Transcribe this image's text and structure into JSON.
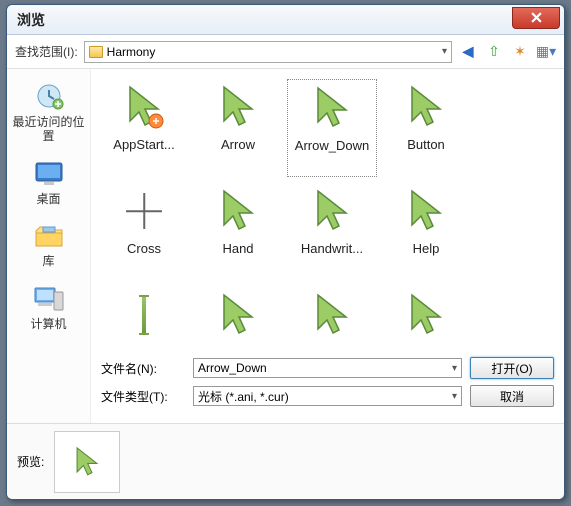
{
  "window": {
    "title": "浏览"
  },
  "toolbar": {
    "lookin_label": "查找范围(I):",
    "folder": "Harmony",
    "icons": {
      "back": "←",
      "up": "↥",
      "new": "📁",
      "views": "▦"
    }
  },
  "sidebar": {
    "items": [
      {
        "label": "最近访问的位置"
      },
      {
        "label": "桌面"
      },
      {
        "label": "库"
      },
      {
        "label": "计算机"
      }
    ]
  },
  "files": [
    {
      "label": "AppStart...",
      "icon": "arrow",
      "badge": true
    },
    {
      "label": "Arrow",
      "icon": "arrow"
    },
    {
      "label": "Arrow_Down",
      "icon": "arrow",
      "selected": true
    },
    {
      "label": "Button",
      "icon": "arrow"
    },
    {
      "label": "Cross",
      "icon": "cross"
    },
    {
      "label": "Hand",
      "icon": "arrow"
    },
    {
      "label": "Handwrit...",
      "icon": "arrow"
    },
    {
      "label": "Help",
      "icon": "arrow"
    },
    {
      "label": "",
      "icon": "ibeam"
    },
    {
      "label": "",
      "icon": "arrow"
    },
    {
      "label": "",
      "icon": "arrow"
    },
    {
      "label": "",
      "icon": "arrow"
    }
  ],
  "fields": {
    "filename_label": "文件名(N):",
    "filename_value": "Arrow_Down",
    "filetype_label": "文件类型(T):",
    "filetype_value": "光标 (*.ani, *.cur)"
  },
  "buttons": {
    "open": "打开(O)",
    "cancel": "取消"
  },
  "preview": {
    "label": "预览:"
  }
}
